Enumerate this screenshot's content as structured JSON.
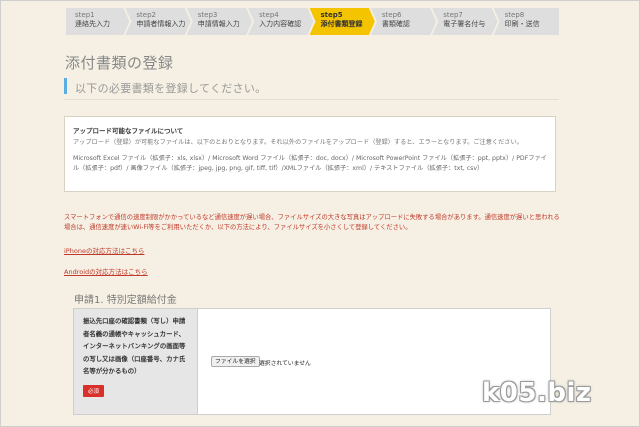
{
  "steps": [
    {
      "num": "step1",
      "label": "連絡先入力"
    },
    {
      "num": "step2",
      "label": "申請者情報入力"
    },
    {
      "num": "step3",
      "label": "申請情報入力"
    },
    {
      "num": "step4",
      "label": "入力内容確認"
    },
    {
      "num": "step5",
      "label": "添付書類登録"
    },
    {
      "num": "step6",
      "label": "書類確認"
    },
    {
      "num": "step7",
      "label": "電子署名付与"
    },
    {
      "num": "step8",
      "label": "印刷・送信"
    }
  ],
  "active_step": 5,
  "page": {
    "title": "添付書類の登録",
    "subtitle": "以下の必要書類を登録してください。"
  },
  "info": {
    "title": "アップロード可能なファイルについて",
    "text": "アップロード（登録）が可能なファイルは、以下のとおりとなります。それ以外のファイルをアップロード（登録）すると、エラーとなります。ご注意ください。",
    "types": "Microsoft Excel ファイル（拡張子：xls, xlsx）/ Microsoft Word ファイル（拡張子：doc, docx）/ Microsoft PowerPoint ファイル（拡張子：ppt, pptx）/ PDFファイル（拡張子：pdf）/ 画像ファイル（拡張子：jpeg, jpg, png, gif, tiff, tif）/XMLファイル（拡張子：xml）/ テキストファイル（拡張子：txt, csv）"
  },
  "warning": "スマートフォンで通信の速度制限がかかっているなど通信速度が遅い場合、ファイルサイズの大きな写真はアップロードに失敗する場合があります。通信速度が遅いと思われる場合は、通信速度が速いWi-Fi等をご利用いただくか、以下の方法により、ファイルサイズを小さくして登録してください。",
  "links": {
    "iphone": "iPhoneの対応方法はこちら",
    "android": "Androidの対応方法はこちら"
  },
  "section": {
    "heading": "申請1. 特別定額給付金",
    "field_label": "振込先口座の確認書類（写し）申請者名義の通帳やキャッシュカード、インターネットバンキングの画面等の写し又は画像（口座番号、カナ氏名等が分かるもの）",
    "required_badge": "必須",
    "file_button": "ファイルを選択",
    "file_status": "選択されていません"
  },
  "watermark": "k05.biz",
  "colors": {
    "background": "#f5f0e3",
    "active_step": "#f5c400",
    "accent_bar": "#5aaee0",
    "warning_text": "#c0392b",
    "required_badge": "#d9302c"
  }
}
